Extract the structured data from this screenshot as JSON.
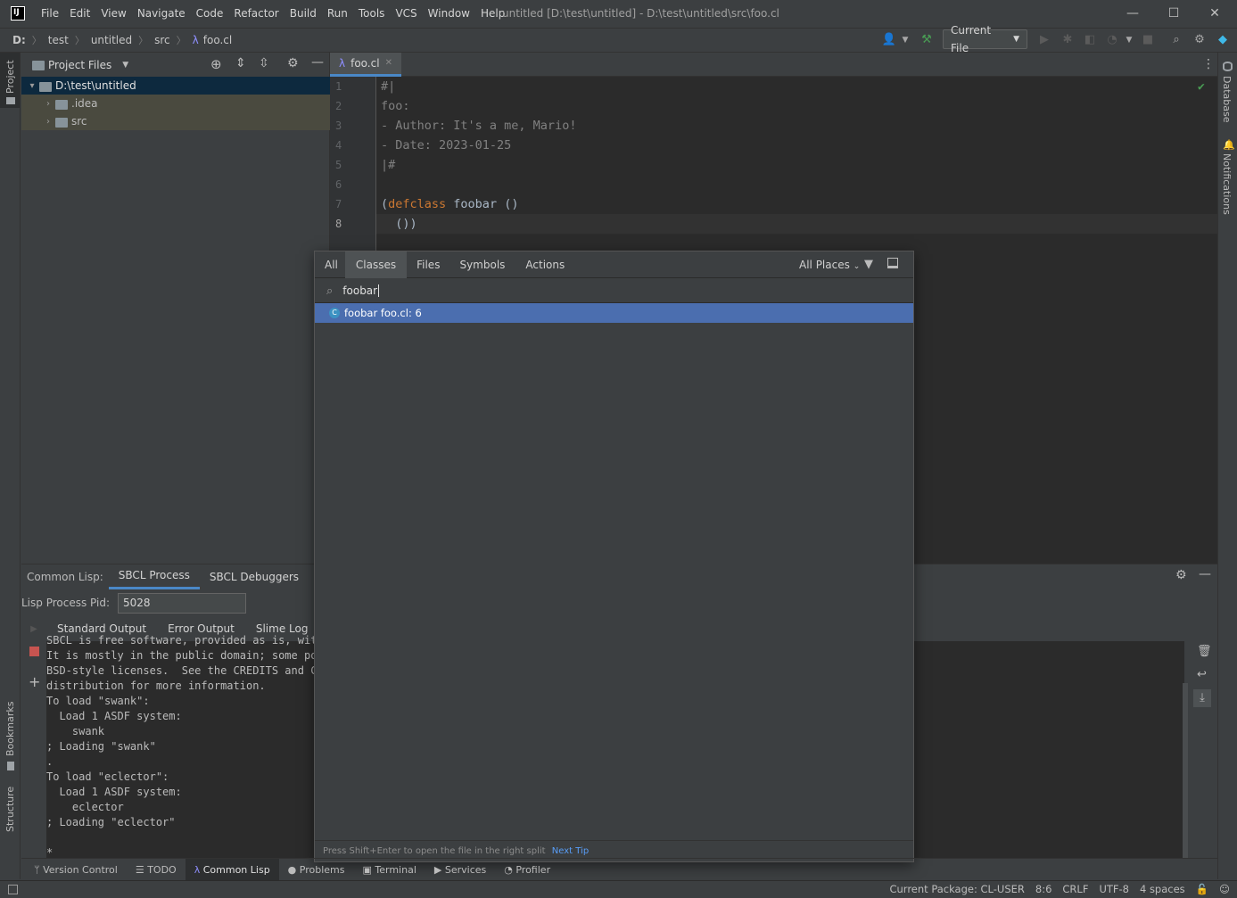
{
  "menu": [
    "File",
    "Edit",
    "View",
    "Navigate",
    "Code",
    "Refactor",
    "Build",
    "Run",
    "Tools",
    "VCS",
    "Window",
    "Help"
  ],
  "window_title": "untitled [D:\\test\\untitled] - D:\\test\\untitled\\src\\foo.cl",
  "window_controls": {
    "minimize": "—",
    "maximize": "☐",
    "close": "✕"
  },
  "breadcrumb": [
    "D:",
    "test",
    "untitled",
    "src",
    "foo.cl"
  ],
  "run_config": "Current File",
  "project_panel": {
    "title": "Project Files",
    "root": "D:\\test\\untitled",
    "children": [
      ".idea",
      "src"
    ]
  },
  "left_strip": {
    "project": "Project",
    "bookmarks": "Bookmarks",
    "structure": "Structure"
  },
  "right_strip": {
    "database": "Database",
    "notifications": "Notifications"
  },
  "editor": {
    "tab_label": "foo.cl",
    "line_numbers": [
      "1",
      "2",
      "3",
      "4",
      "5",
      "6",
      "7",
      "8"
    ],
    "lines": [
      {
        "text": "#|"
      },
      {
        "text": "foo:"
      },
      {
        "text": "- Author: It's a me, Mario!"
      },
      {
        "text": "- Date: 2023-01-25"
      },
      {
        "text": "|#"
      },
      {
        "text": ""
      },
      {
        "keyword": "defclass",
        "open": "(",
        "rest": " foobar ()"
      },
      {
        "text": "  ())"
      }
    ]
  },
  "search_popup": {
    "tabs": [
      "All",
      "Classes",
      "Files",
      "Symbols",
      "Actions"
    ],
    "active_tab": "Classes",
    "scope": "All Places",
    "query": "foobar",
    "result": {
      "icon": "C",
      "text": "foobar foo.cl: 6"
    },
    "footer_hint": "Press Shift+Enter to open the file in the right split",
    "footer_link": "Next Tip"
  },
  "bottom_panel": {
    "tabs_label": "Common Lisp:",
    "tabs": [
      "SBCL Process",
      "SBCL Debuggers"
    ],
    "pid_label": "Lisp Process Pid:",
    "pid_value": "5028",
    "output_tabs": [
      "Standard Output",
      "Error Output",
      "Slime Log"
    ],
    "console_lines": [
      "SBCL is free software, provided as is, with",
      "It is mostly in the public domain; some por",
      "BSD-style licenses.  See the CREDITS and CO",
      "distribution for more information.",
      "To load \"swank\":",
      "  Load 1 ASDF system:",
      "    swank",
      "; Loading \"swank\"",
      ".",
      "To load \"eclector\":",
      "  Load 1 ASDF system:",
      "    eclector",
      "; Loading \"eclector\"",
      "",
      "*"
    ]
  },
  "tool_windows": [
    {
      "icon": "branch-icon",
      "glyph": "ᛘ",
      "label": "Version Control"
    },
    {
      "icon": "todo-icon",
      "glyph": "☰",
      "label": "TODO"
    },
    {
      "icon": "lambda-icon",
      "glyph": "λ",
      "label": "Common Lisp",
      "active": true
    },
    {
      "icon": "problems-icon",
      "glyph": "●",
      "label": "Problems"
    },
    {
      "icon": "terminal-icon",
      "glyph": "▣",
      "label": "Terminal"
    },
    {
      "icon": "services-icon",
      "glyph": "▶",
      "label": "Services"
    },
    {
      "icon": "profiler-icon",
      "glyph": "◔",
      "label": "Profiler"
    }
  ],
  "status_bar": {
    "package": "Current Package: CL-USER",
    "position": "8:6",
    "line_sep": "CRLF",
    "encoding": "UTF-8",
    "indent": "4 spaces"
  },
  "colors": {
    "accent": "#4a88c7",
    "selection": "#4b6eaf",
    "keyword": "#cc7832",
    "stop": "#c75450",
    "build": "#499c54"
  }
}
